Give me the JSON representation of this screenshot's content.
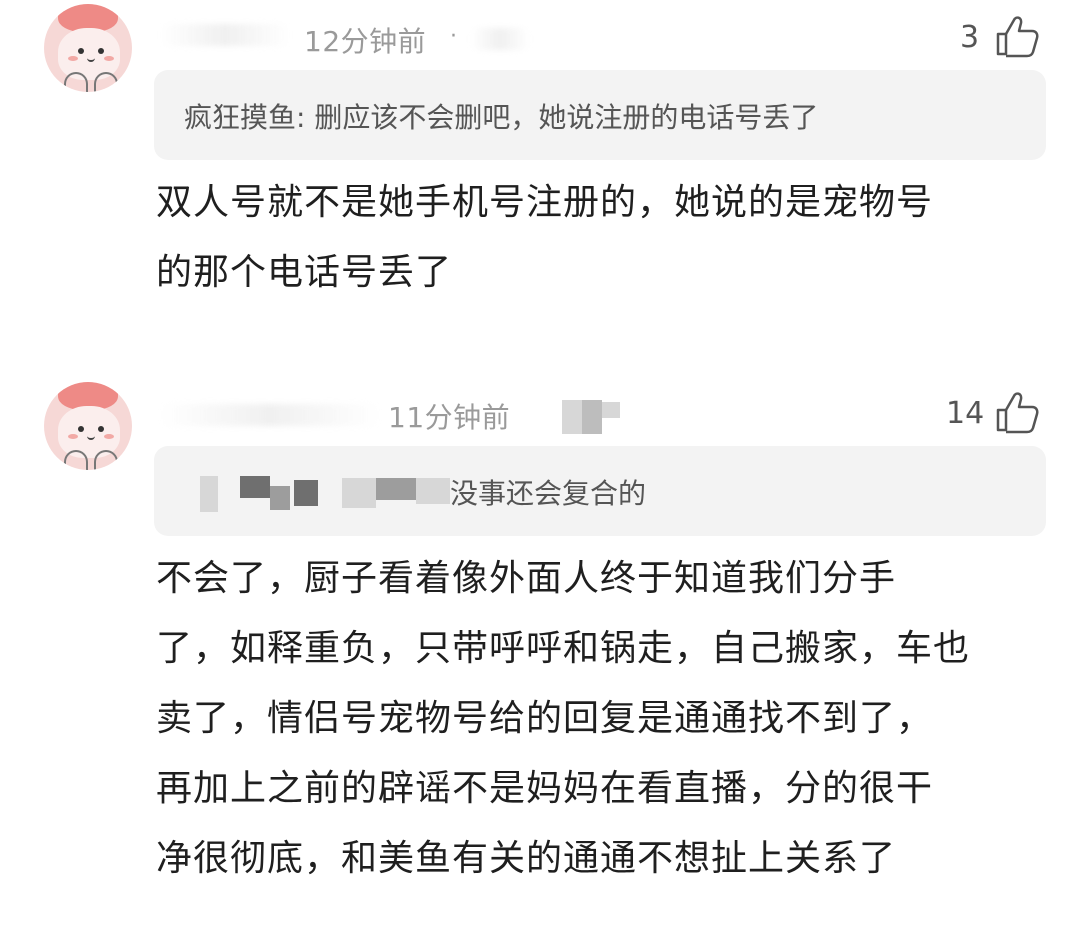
{
  "comments": [
    {
      "time": "12分钟前",
      "dot": "·",
      "likes": "3",
      "quote_user": "疯狂摸鱼:",
      "quote_text": "删应该不会删吧，她说注册的电话号丢了",
      "body_lines": [
        "双人号就不是她手机号注册的，她说的是宠物号",
        "的那个电话号丢了"
      ]
    },
    {
      "time": "11分钟前",
      "likes": "14",
      "quote_text": "没事还会复合的",
      "body_lines": [
        "不会了，厨子看着像外面人终于知道我们分手",
        "了，如释重负，只带呼呼和锅走，自己搬家，车也",
        "卖了，情侣号宠物号给的回复是通通找不到了，",
        "再加上之前的辟谣不是妈妈在看直播，分的很干",
        "净很彻底，和美鱼有关的通通不想扯上关系了"
      ]
    }
  ],
  "icons": {
    "avatar": "cartoon-avatar",
    "like": "thumbs-up-icon"
  },
  "colors": {
    "quote_bg": "#f3f3f3",
    "meta": "#9a9a9a",
    "body": "#1f1f1f"
  }
}
